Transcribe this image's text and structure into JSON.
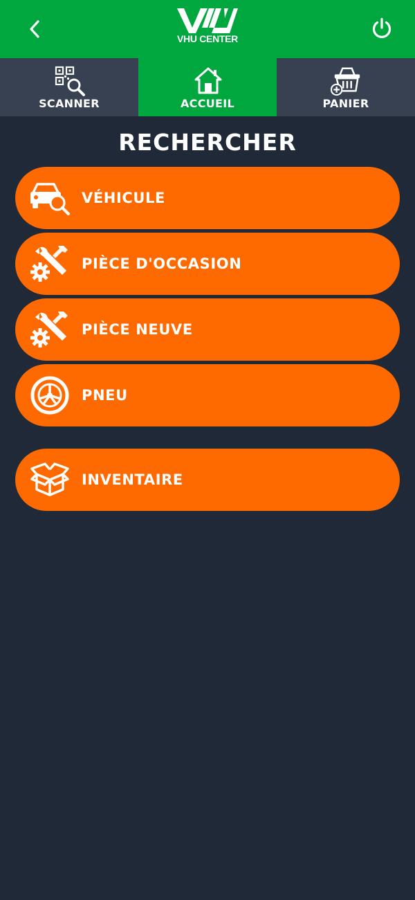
{
  "header": {
    "logo_text": "VHU CENTER",
    "back_icon": "chevron-left-icon",
    "power_icon": "power-icon",
    "background": "#00a63e"
  },
  "tabs": [
    {
      "label": "SCANNER",
      "icon": "qr-search-icon",
      "active": false
    },
    {
      "label": "ACCUEIL",
      "icon": "home-icon",
      "active": true
    },
    {
      "label": "PANIER",
      "icon": "basket-add-icon",
      "active": false
    }
  ],
  "main": {
    "title": "RECHERCHER",
    "buttons": [
      {
        "label": "VÉHICULE",
        "icon": "car-search-icon"
      },
      {
        "label": "PIÈCE D'OCCASION",
        "icon": "wrench-gear-icon"
      },
      {
        "label": "PIÈCE NEUVE",
        "icon": "wrench-gear-icon"
      },
      {
        "label": "PNEU",
        "icon": "tire-icon"
      },
      {
        "label": "INVENTAIRE",
        "icon": "box-icon"
      }
    ]
  },
  "colors": {
    "background": "#1f2937",
    "tab_inactive": "#374151",
    "accent_green": "#00a63e",
    "button_orange": "#ff6a00",
    "text": "#ffffff"
  }
}
